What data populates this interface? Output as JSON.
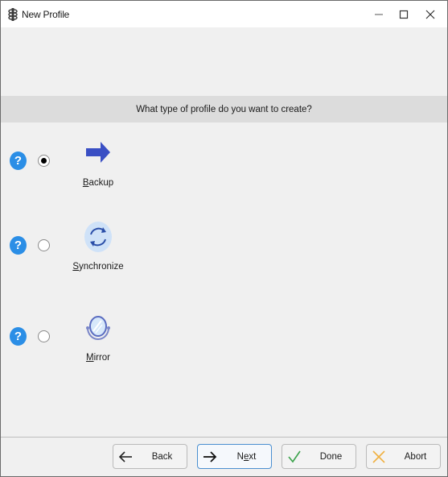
{
  "window": {
    "title": "New Profile",
    "app_icon": "freefilesync-icon",
    "controls": {
      "minimize": "minimize-icon",
      "maximize": "maximize-icon",
      "close": "close-icon"
    }
  },
  "prompt": "What type of profile do you want to create?",
  "options": [
    {
      "id": "backup",
      "label_mnemonic": "B",
      "label_rest": "ackup",
      "icon": "arrow-right-icon",
      "selected": true,
      "help_icon": "help-icon"
    },
    {
      "id": "synchronize",
      "label_mnemonic": "S",
      "label_rest": "ynchronize",
      "icon": "sync-icon",
      "selected": false,
      "help_icon": "help-icon"
    },
    {
      "id": "mirror",
      "label_mnemonic": "M",
      "label_rest": "irror",
      "icon": "mirror-icon",
      "selected": false,
      "help_icon": "help-icon"
    }
  ],
  "help_glyph": "?",
  "buttons": {
    "back": {
      "label": "Back",
      "icon": "arrow-left-icon"
    },
    "next": {
      "label_pre": "N",
      "label_mnemonic": "e",
      "label_post": "xt",
      "icon": "arrow-right-icon",
      "default": true
    },
    "done": {
      "label": "Done",
      "icon": "checkmark-icon",
      "icon_color": "#3aa24a"
    },
    "abort": {
      "label": "Abort",
      "icon": "x-icon",
      "icon_color": "#f0b040"
    }
  },
  "colors": {
    "help_blue": "#2b8ee6",
    "backup_arrow": "#3a4fc4",
    "sync_bg": "#cfe2f8",
    "sync_arrows": "#2a4ea8",
    "prompt_bar": "#dcdcdc"
  }
}
